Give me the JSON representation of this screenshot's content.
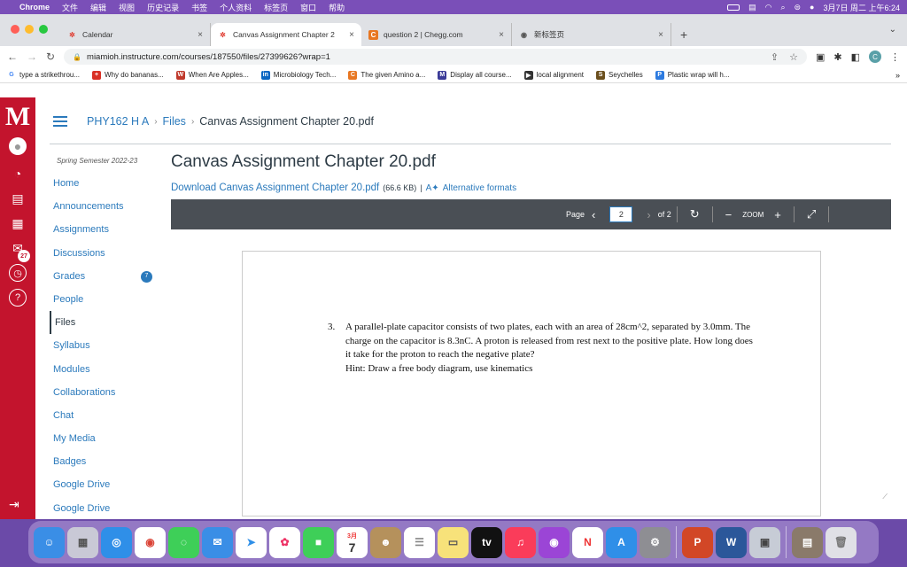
{
  "menubar": {
    "app": "Chrome",
    "items": [
      "文件",
      "编辑",
      "视图",
      "历史记录",
      "书签",
      "个人资料",
      "标签页",
      "窗口",
      "帮助"
    ],
    "datetime": "3月7日 周二 上午6:24"
  },
  "tabs": [
    {
      "label": "Calendar",
      "icon": "canvas-icon",
      "color": "#e03c31",
      "active": false
    },
    {
      "label": "Canvas Assignment Chapter 2",
      "icon": "canvas-icon",
      "color": "#e03c31",
      "active": true
    },
    {
      "label": "question 2 | Chegg.com",
      "icon": "chegg-icon",
      "color": "#e87722",
      "active": false
    },
    {
      "label": "新标签页",
      "icon": "globe-icon",
      "color": "#555555",
      "active": false
    }
  ],
  "address": {
    "url": "miamioh.instructure.com/courses/187550/files/27399626?wrap=1"
  },
  "bookmarks": [
    {
      "label": "type a strikethrou...",
      "icon": "G",
      "color": "#4285f4"
    },
    {
      "label": "Why do bananas...",
      "icon": "+",
      "color": "#d93025"
    },
    {
      "label": "When Are Apples...",
      "icon": "W",
      "color": "#c0392b"
    },
    {
      "label": "Microbiology Tech...",
      "icon": "in",
      "color": "#0a66c2"
    },
    {
      "label": "The given Amino a...",
      "icon": "C",
      "color": "#e87722"
    },
    {
      "label": "Display all course...",
      "icon": "M",
      "color": "#3b3b98"
    },
    {
      "label": "local alignment",
      "icon": "▶",
      "color": "#333333"
    },
    {
      "label": "Seychelles",
      "icon": "S",
      "color": "#6b4f1d"
    },
    {
      "label": "Plastic wrap will h...",
      "icon": "P",
      "color": "#2d7be0"
    }
  ],
  "bookmarks_more": "»",
  "global_nav": {
    "logo": "M",
    "badge": "27"
  },
  "breadcrumb": {
    "course": "PHY162 H A",
    "section": "Files",
    "current": "Canvas Assignment Chapter 20.pdf"
  },
  "course_nav": {
    "term": "Spring Semester 2022-23",
    "items": [
      {
        "label": "Home"
      },
      {
        "label": "Announcements"
      },
      {
        "label": "Assignments"
      },
      {
        "label": "Discussions"
      },
      {
        "label": "Grades",
        "badge": "7"
      },
      {
        "label": "People"
      },
      {
        "label": "Files",
        "active": true
      },
      {
        "label": "Syllabus"
      },
      {
        "label": "Modules"
      },
      {
        "label": "Collaborations"
      },
      {
        "label": "Chat"
      },
      {
        "label": "My Media"
      },
      {
        "label": "Badges"
      },
      {
        "label": "Google Drive"
      },
      {
        "label": "Google Drive"
      }
    ]
  },
  "file": {
    "title": "Canvas Assignment Chapter 20.pdf",
    "download_label": "Download Canvas Assignment Chapter 20.pdf",
    "size": "(66.6 KB)",
    "divider": "|",
    "alt_formats": "Alternative formats"
  },
  "viewer": {
    "page_label": "Page",
    "page_value": "2",
    "of_label": "of 2",
    "zoom_label": "ZOOM"
  },
  "question": {
    "number": "3.",
    "text": "A parallel-plate capacitor consists of two plates, each with an area of 28cm^2, separated by 3.0mm. The charge on the capacitor is 8.3nC. A proton is released from rest next to the positive plate. How long does it take for the proton to reach the negative plate?",
    "hint": "Hint: Draw a free body diagram, use kinematics"
  },
  "dock": {
    "calendar_month": "3月",
    "calendar_day": "7",
    "tv_label": "tv"
  }
}
